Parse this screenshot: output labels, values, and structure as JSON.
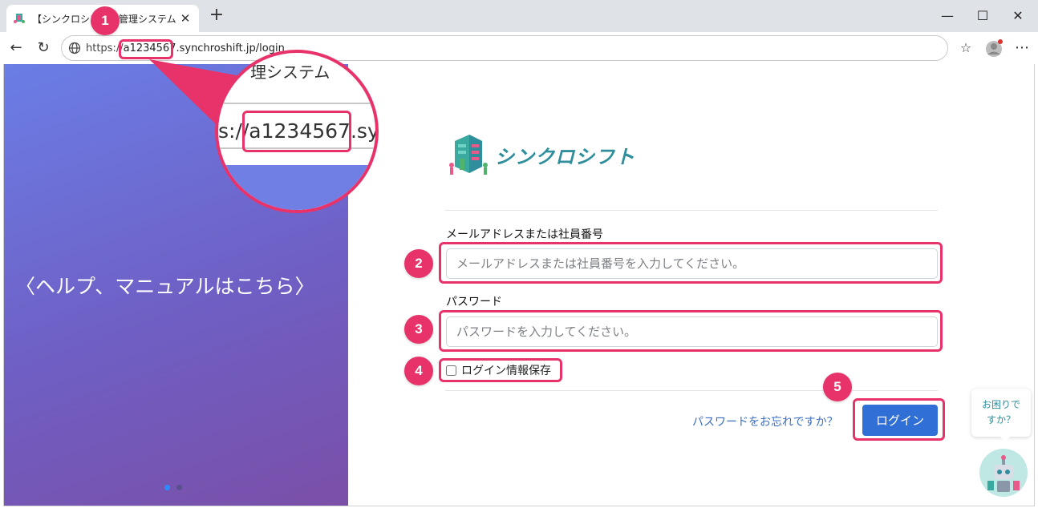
{
  "browser": {
    "tab_title": "【シンクロシフト】管理システム",
    "url_prefix": "https://",
    "url_host": "a1234567.synchroshift.jp/login"
  },
  "left_panel": {
    "help_link": "〈ヘルプ、マニュアルはこちら〉"
  },
  "logo": {
    "text": "シンクロシフト"
  },
  "form": {
    "email_label": "メールアドレスまたは社員番号",
    "email_placeholder": "メールアドレスまたは社員番号を入力してください。",
    "password_label": "パスワード",
    "password_placeholder": "パスワードを入力してください。",
    "remember_label": "ログイン情報保存",
    "forgot_link": "パスワードをお忘れですか？",
    "login_button": "ログイン"
  },
  "help_widget": {
    "line1": "お困りで",
    "line2": "すか？"
  },
  "callout": {
    "title_fragment": "理システム",
    "url_prefix_fragment": "s://",
    "url_highlight": "a1234567",
    "url_suffix_fragment": ".syn"
  },
  "annotations": [
    "1",
    "2",
    "3",
    "4",
    "5"
  ],
  "colors": {
    "highlight": "#e8336a",
    "primary": "#2f6fd6",
    "brand": "#2f8e9b"
  },
  "icons": [
    "favicon",
    "close-icon",
    "plus-icon",
    "back-arrow-icon",
    "refresh-icon",
    "globe-icon",
    "favorites-icon",
    "avatar",
    "more-icon",
    "minimize-icon",
    "maximize-icon",
    "window-close-icon",
    "robot-icon"
  ]
}
